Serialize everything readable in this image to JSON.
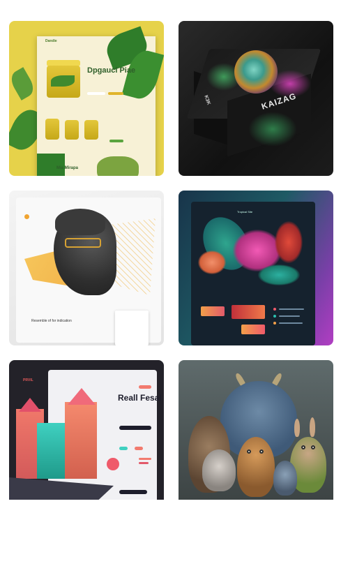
{
  "gallery": {
    "cards": [
      {
        "name": "honey-jar-website",
        "texts": {
          "brand": "Dandie",
          "headline": "Dpgaucl Piae",
          "footer": "Mia Mirapa"
        }
      },
      {
        "name": "kaizag-box",
        "texts": {
          "front": "KAIZAG",
          "side": "K3K"
        }
      },
      {
        "name": "statue-landing-page",
        "texts": {
          "caption": "Resemble of for indication"
        }
      },
      {
        "name": "tropical-bird-site",
        "texts": {
          "header": "Tropical Site"
        }
      },
      {
        "name": "isometric-houses-site",
        "texts": {
          "brand": "PRVIL",
          "headline": "Reall Fesal"
        }
      },
      {
        "name": "creatures-render",
        "texts": {}
      }
    ]
  },
  "colors": {
    "accent_yellow": "#e6d24a",
    "dark_box": "#111111",
    "purple": "#b13ec2",
    "coral": "#f27a6e"
  }
}
